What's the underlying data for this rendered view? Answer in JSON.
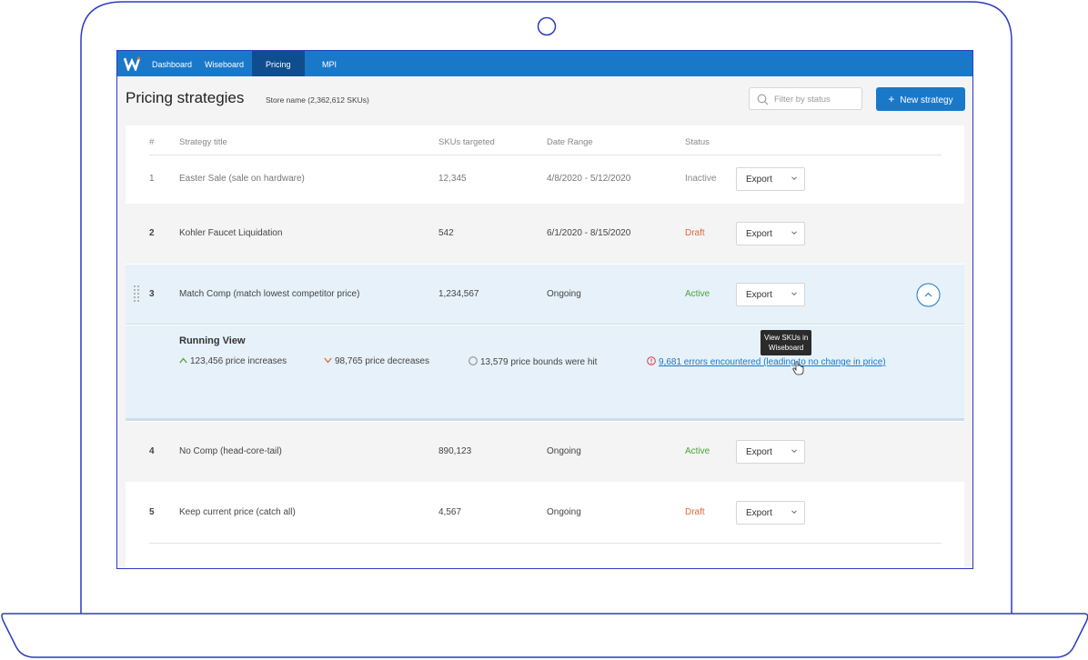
{
  "nav": {
    "items": [
      {
        "label": "Dashboard"
      },
      {
        "label": "Wiseboard"
      },
      {
        "label": "Pricing"
      },
      {
        "label": "MPI"
      }
    ]
  },
  "header": {
    "title": "Pricing strategies",
    "store": "Store name (2,362,612 SKUs)",
    "filter_placeholder": "Filter by status",
    "new_button": "New strategy"
  },
  "table": {
    "columns": [
      "#",
      "Strategy title",
      "SKUs targeted",
      "Date Range",
      "Status"
    ],
    "rows": [
      {
        "num": "1",
        "title": "Easter Sale (sale on hardware)",
        "skus": "12,345",
        "dates": "4/8/2020 - 5/12/2020",
        "status": "Inactive",
        "export": "Export"
      },
      {
        "num": "2",
        "title": "Kohler Faucet Liquidation",
        "skus": "542",
        "dates": "6/1/2020 - 8/15/2020",
        "status": "Draft",
        "export": "Export"
      },
      {
        "num": "3",
        "title": "Match Comp (match lowest competitor price)",
        "skus": "1,234,567",
        "dates": "Ongoing",
        "status": "Active",
        "export": "Export"
      },
      {
        "num": "4",
        "title": "No Comp (head-core-tail)",
        "skus": "890,123",
        "dates": "Ongoing",
        "status": "Active",
        "export": "Export"
      },
      {
        "num": "5",
        "title": "Keep current price (catch all)",
        "skus": "4,567",
        "dates": "Ongoing",
        "status": "Draft",
        "export": "Export"
      }
    ]
  },
  "running_view": {
    "title": "Running View",
    "increases": "123,456 price increases",
    "decreases": "98,765 price decreases",
    "bounds": "13,579 price bounds were hit",
    "errors": "9,681 errors encountered (leading to no change in price)",
    "tooltip_line1": "View SKUs in",
    "tooltip_line2": "Wiseboard"
  },
  "colors": {
    "brand": "#1a78c9",
    "nav_active": "#0f4e8e",
    "frame": "#2a3bc4",
    "active": "#4aa43a",
    "draft": "#e0673b",
    "error": "#d9393e",
    "expanded_bg": "#e6f1f9"
  }
}
